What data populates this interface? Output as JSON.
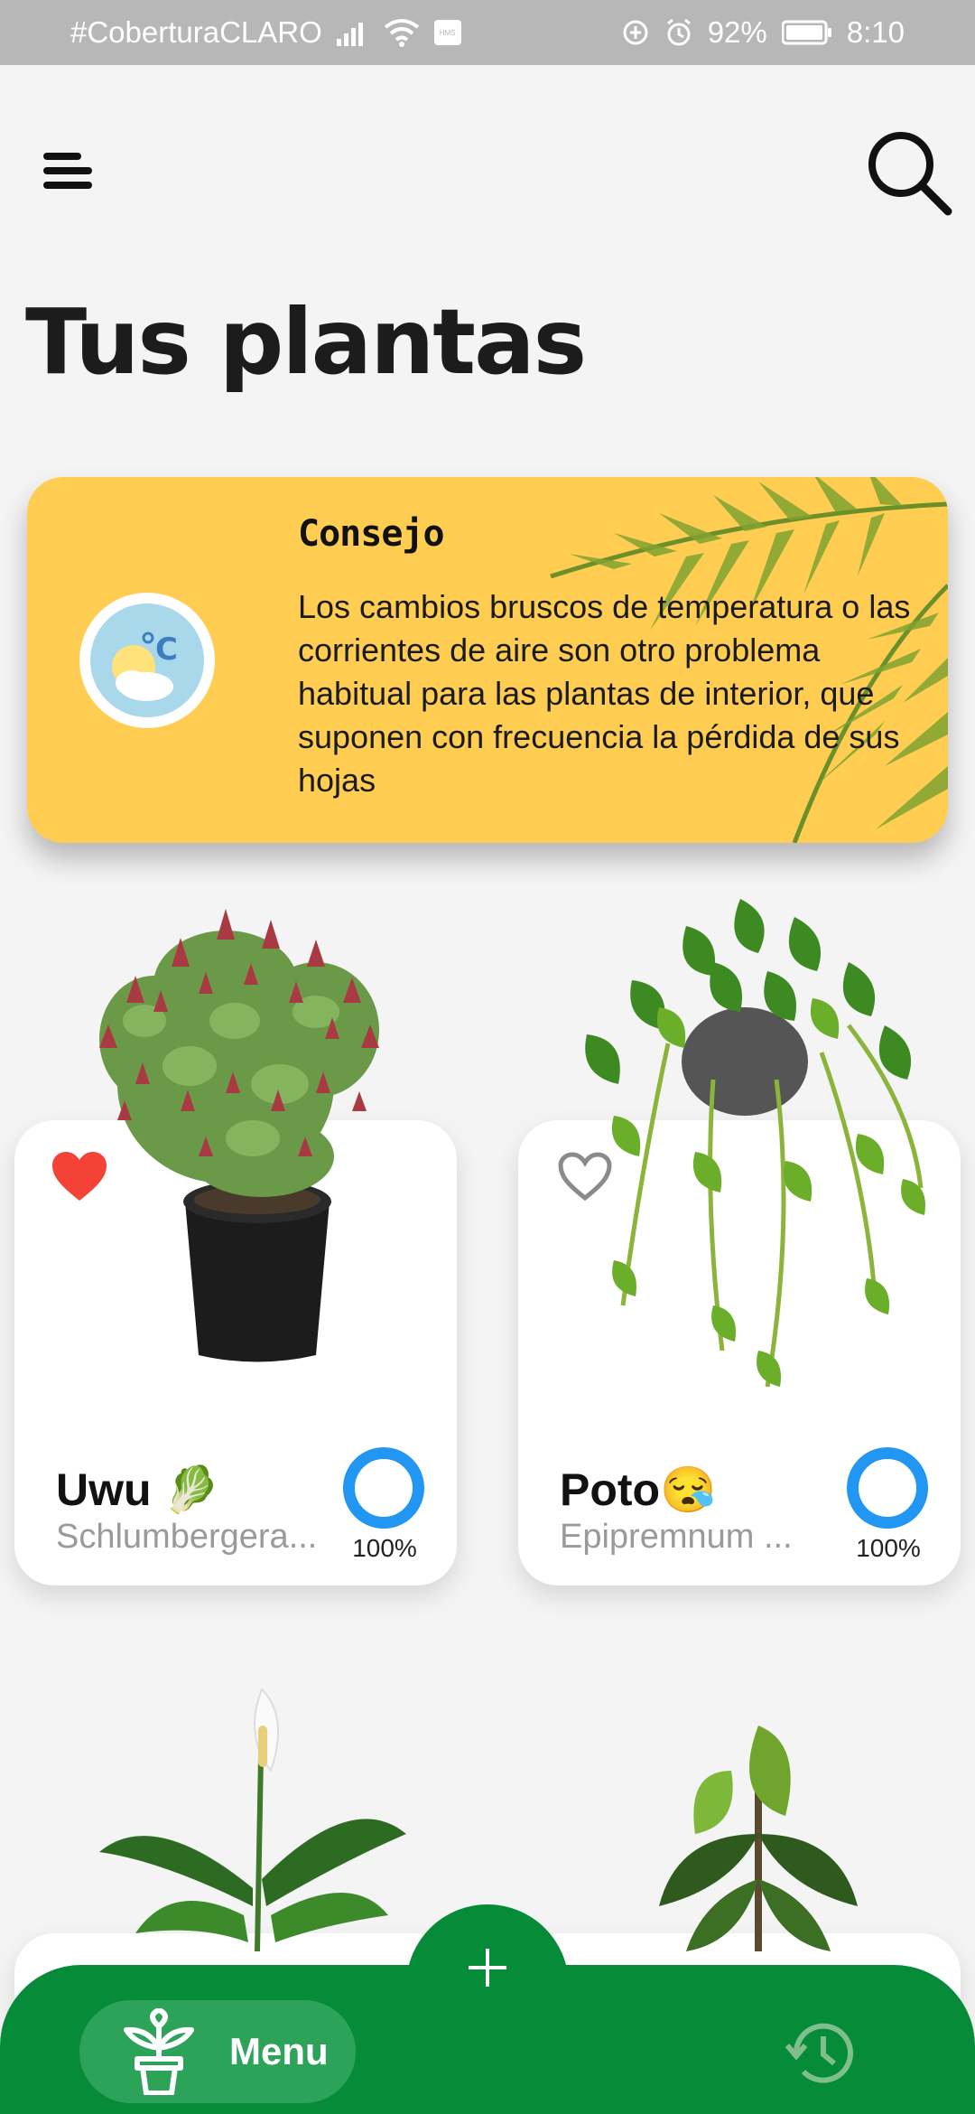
{
  "status_bar": {
    "carrier": "#CoberturaCLARO",
    "battery": "92%",
    "time": "8:10",
    "sim_badge": "HMS"
  },
  "header": {
    "title": "Tus plantas"
  },
  "tip": {
    "title": "Consejo",
    "text": "Los cambios bruscos de temperatura o las corrientes de aire son otro problema habitual para las plantas de interior, que suponen con frecuencia la pérdida de sus hojas",
    "icon": "temperature-weather-icon"
  },
  "plants": [
    {
      "name": "Uwu 🥬",
      "species": "Schlumbergera...",
      "water_percent": "100%",
      "favorite": true
    },
    {
      "name": "Poto😪",
      "species": "Epipremnum ...",
      "water_percent": "100%",
      "favorite": false
    }
  ],
  "bottom_nav": {
    "menu_label": "Menu",
    "fab_icon": "plus-icon",
    "history_icon": "history-icon"
  },
  "colors": {
    "accent_green": "#068c38",
    "pill_green": "#2da35a",
    "tip_yellow": "#ffcd52",
    "water_blue": "#2196f3",
    "favorite_red": "#f44336"
  }
}
